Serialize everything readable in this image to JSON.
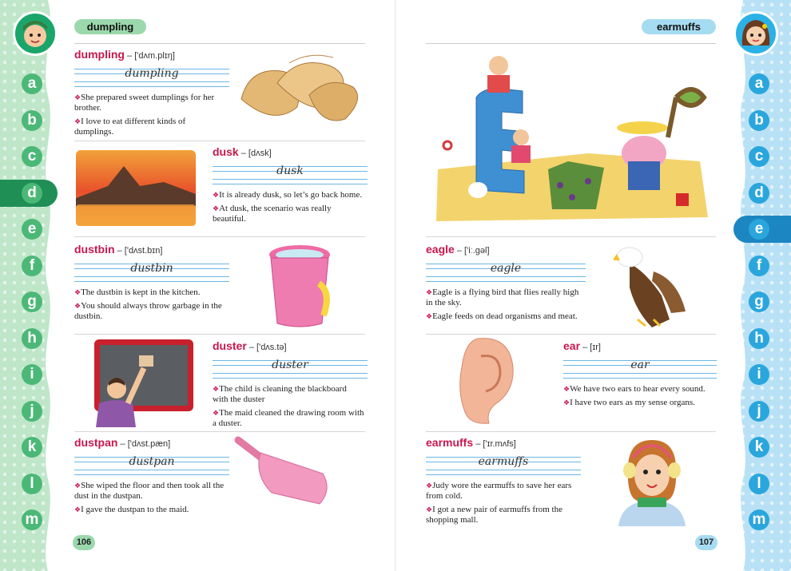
{
  "left_page": {
    "header": "dumpling",
    "page_number": "106",
    "letters": [
      "a",
      "b",
      "c",
      "d",
      "e",
      "f",
      "g",
      "h",
      "i",
      "j",
      "k",
      "l",
      "m"
    ],
    "active_letter": "d",
    "entries": [
      {
        "word": "dumpling",
        "phonetic": "['dʌm.plɪŋ]",
        "cursive": "dumpling",
        "sentences": [
          "She prepared sweet dumplings for her brother.",
          "I love to eat different kinds of dumplings."
        ]
      },
      {
        "word": "dusk",
        "phonetic": "[dʌsk]",
        "cursive": "dusk",
        "sentences": [
          "It is already dusk, so let’s go back home.",
          "At dusk, the scenario was really beautiful."
        ]
      },
      {
        "word": "dustbin",
        "phonetic": "['dʌst.bɪn]",
        "cursive": "dustbin",
        "sentences": [
          "The dustbin is kept in the kitchen.",
          "You should always throw garbage in the dustbin."
        ]
      },
      {
        "word": "duster",
        "phonetic": "['dʌs.tə]",
        "cursive": "duster",
        "sentences": [
          "The child is cleaning the blackboard with the duster",
          "The maid cleaned the drawing room with a duster."
        ]
      },
      {
        "word": "dustpan",
        "phonetic": "['dʌst.pæn]",
        "cursive": "dustpan",
        "sentences": [
          "She wiped the floor and then took all the dust in the dustpan.",
          "I gave the dustpan to the maid."
        ]
      }
    ]
  },
  "right_page": {
    "header": "earmuffs",
    "page_number": "107",
    "letters": [
      "a",
      "b",
      "c",
      "d",
      "e",
      "f",
      "g",
      "h",
      "i",
      "j",
      "k",
      "l",
      "m"
    ],
    "active_letter": "e",
    "entries": [
      {
        "word": "eagle",
        "phonetic": "['iː.gəl]",
        "cursive": "eagle",
        "sentences": [
          "Eagle is a flying bird that flies really high in the sky.",
          "Eagle feeds on dead organisms and meat."
        ]
      },
      {
        "word": "ear",
        "phonetic": "[ɪr]",
        "cursive": "ear",
        "sentences": [
          "We have two ears to hear every sound.",
          "I have two ears as my sense organs."
        ]
      },
      {
        "word": "earmuffs",
        "phonetic": "['ɪr.mʌfs]",
        "cursive": "earmuffs",
        "sentences": [
          "Judy wore the earmuffs to save her ears from cold.",
          "I got a new pair of earmuffs from the shopping mall."
        ]
      }
    ]
  },
  "bullet_glyph": "❖",
  "colors": {
    "word": "#c8174d",
    "left_accent": "#4cb877",
    "right_accent": "#2aa6dd",
    "ruled_line": "#6bb6e6"
  }
}
